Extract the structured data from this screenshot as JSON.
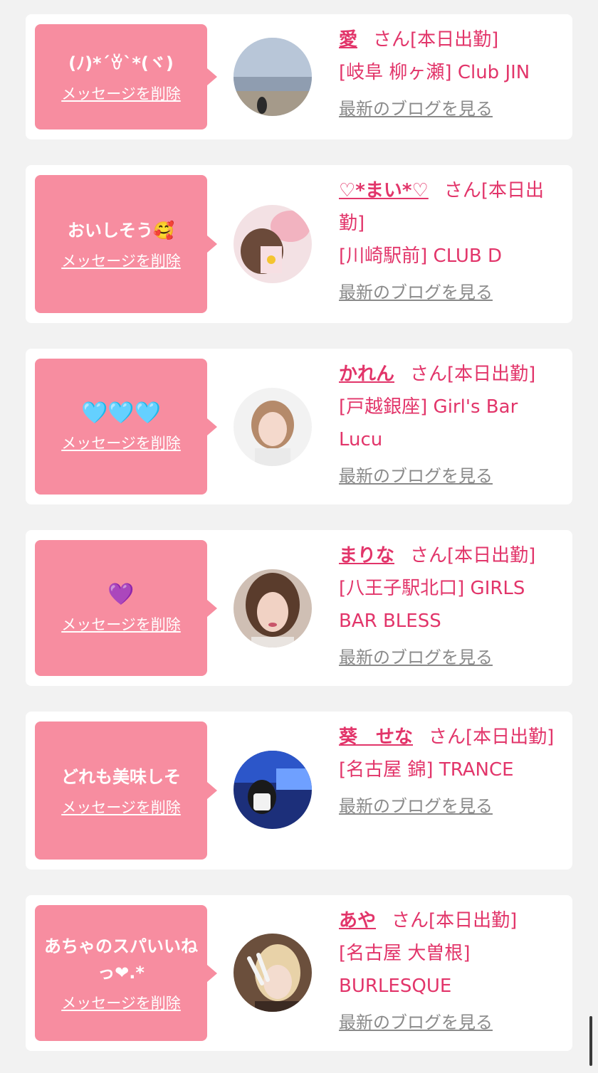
{
  "colors": {
    "page_background": "#f2f2f2",
    "card_background": "#ffffff",
    "bubble_background": "#f78da0",
    "accent_pink": "#e2356a",
    "link_gray": "#8a8a8a"
  },
  "labels": {
    "delete_message": "メッセージを削除",
    "latest_blog": "最新のブログを見る"
  },
  "entries": [
    {
      "message": "(ﾉ)*´ꈊ`*(ヾ)",
      "name": "愛",
      "suffix": "さん[本日出勤]",
      "shop": "[岐阜 柳ヶ瀬] Club JIN"
    },
    {
      "message": "おいしそう🥰",
      "name": "♡*まい*♡",
      "suffix": "さん[本日出勤]",
      "shop": "[川崎駅前] CLUB D"
    },
    {
      "message": "🩵🩵🩵",
      "name": "かれん",
      "suffix": "さん[本日出勤]",
      "shop": "[戸越銀座] Girl's Bar Lucu"
    },
    {
      "message": "💜",
      "name": "まりな",
      "suffix": "さん[本日出勤]",
      "shop": "[八王子駅北口] GIRLS BAR BLESS"
    },
    {
      "message": "どれも美味しそ",
      "name": "葵　せな",
      "suffix": "さん[本日出勤]",
      "shop": "[名古屋 錦] TRANCE"
    },
    {
      "message": "あちゃのスパいいねっ❤︎.*",
      "name": "あや",
      "suffix": "さん[本日出勤]",
      "shop": "[名古屋 大曽根] BURLESQUE"
    }
  ]
}
